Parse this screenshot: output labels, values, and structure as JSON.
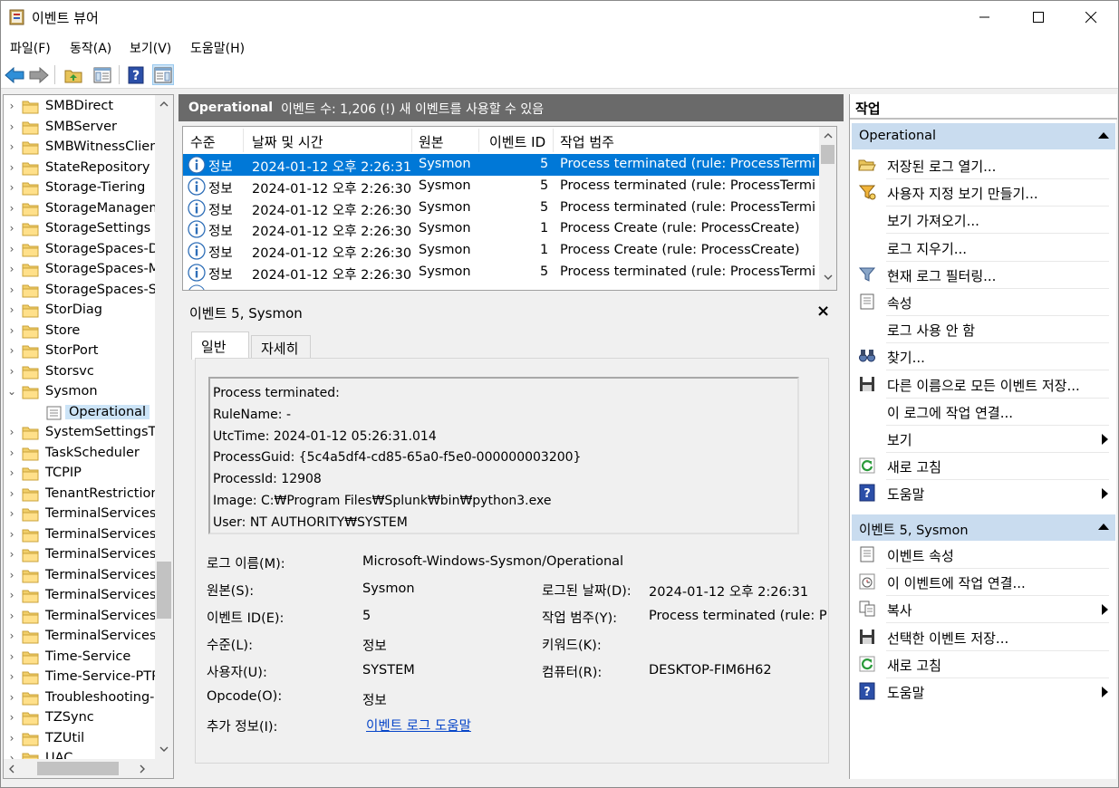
{
  "window": {
    "title": "이벤트 뷰어"
  },
  "menu": [
    "파일(F)",
    "동작(A)",
    "보기(V)",
    "도움말(H)"
  ],
  "tree": {
    "items": [
      {
        "label": "SMBDirect",
        "expanded": false
      },
      {
        "label": "SMBServer",
        "expanded": false
      },
      {
        "label": "SMBWitnessClient",
        "expanded": false
      },
      {
        "label": "StateRepository",
        "expanded": false
      },
      {
        "label": "Storage-Tiering",
        "expanded": false
      },
      {
        "label": "StorageManageme",
        "expanded": false
      },
      {
        "label": "StorageSettings",
        "expanded": false
      },
      {
        "label": "StorageSpaces-Dri",
        "expanded": false
      },
      {
        "label": "StorageSpaces-Ma",
        "expanded": false
      },
      {
        "label": "StorageSpaces-Spa",
        "expanded": false
      },
      {
        "label": "StorDiag",
        "expanded": false
      },
      {
        "label": "Store",
        "expanded": false
      },
      {
        "label": "StorPort",
        "expanded": false
      },
      {
        "label": "Storsvc",
        "expanded": false
      },
      {
        "label": "Sysmon",
        "expanded": true
      },
      {
        "label": "Operational",
        "child": true,
        "selected": true
      },
      {
        "label": "SystemSettingsThr",
        "expanded": false
      },
      {
        "label": "TaskScheduler",
        "expanded": false
      },
      {
        "label": "TCPIP",
        "expanded": false
      },
      {
        "label": "TenantRestrictions",
        "expanded": false
      },
      {
        "label": "TerminalServices-C",
        "expanded": false
      },
      {
        "label": "TerminalServices-C",
        "expanded": false
      },
      {
        "label": "TerminalServices-L",
        "expanded": false
      },
      {
        "label": "TerminalServices-F",
        "expanded": false
      },
      {
        "label": "TerminalServices-F",
        "expanded": false
      },
      {
        "label": "TerminalServices-F",
        "expanded": false
      },
      {
        "label": "TerminalServices-S",
        "expanded": false
      },
      {
        "label": "Time-Service",
        "expanded": false
      },
      {
        "label": "Time-Service-PTP-",
        "expanded": false
      },
      {
        "label": "Troubleshooting-F",
        "expanded": false
      },
      {
        "label": "TZSync",
        "expanded": false
      },
      {
        "label": "TZUtil",
        "expanded": false
      },
      {
        "label": "UAC",
        "expanded": false
      }
    ]
  },
  "log_header": {
    "name": "Operational",
    "count_text": "이벤트 수: 1,206 (!) 새 이벤트를 사용할 수 있음"
  },
  "grid": {
    "columns": [
      "수준",
      "날짜 및 시간",
      "원본",
      "이벤트 ID",
      "작업 범주"
    ],
    "rows": [
      {
        "level": "정보",
        "datetime": "2024-01-12 오후 2:26:31",
        "source": "Sysmon",
        "id": "5",
        "category": "Process terminated (rule: ProcessTermina..."
      },
      {
        "level": "정보",
        "datetime": "2024-01-12 오후 2:26:30",
        "source": "Sysmon",
        "id": "5",
        "category": "Process terminated (rule: ProcessTermina..."
      },
      {
        "level": "정보",
        "datetime": "2024-01-12 오후 2:26:30",
        "source": "Sysmon",
        "id": "5",
        "category": "Process terminated (rule: ProcessTermina..."
      },
      {
        "level": "정보",
        "datetime": "2024-01-12 오후 2:26:30",
        "source": "Sysmon",
        "id": "1",
        "category": "Process Create (rule: ProcessCreate)"
      },
      {
        "level": "정보",
        "datetime": "2024-01-12 오후 2:26:30",
        "source": "Sysmon",
        "id": "1",
        "category": "Process Create (rule: ProcessCreate)"
      },
      {
        "level": "정보",
        "datetime": "2024-01-12 오후 2:26:30",
        "source": "Sysmon",
        "id": "5",
        "category": "Process terminated (rule: ProcessTermina..."
      }
    ]
  },
  "detail": {
    "title": "이벤트 5, Sysmon",
    "close": "×",
    "tabs": [
      "일반",
      "자세히"
    ],
    "message_lines": [
      "Process terminated:",
      "RuleName: -",
      "UtcTime: 2024-01-12 05:26:31.014",
      "ProcessGuid: {5c4a5df4-cd85-65a0-f5e0-000000003200}",
      "ProcessId: 12908",
      "Image: C:₩Program Files₩Splunk₩bin₩python3.exe",
      "User: NT AUTHORITY₩SYSTEM"
    ],
    "props": {
      "log_name_label": "로그 이름(M):",
      "log_name": "Microsoft-Windows-Sysmon/Operational",
      "source_label": "원본(S):",
      "source": "Sysmon",
      "logged_label": "로그된 날짜(D):",
      "logged": "2024-01-12 오후 2:26:31",
      "event_id_label": "이벤트 ID(E):",
      "event_id": "5",
      "task_label": "작업 범주(Y):",
      "task": "Process terminated (rule: P",
      "level_label": "수준(L):",
      "level": "정보",
      "keywords_label": "키워드(K):",
      "user_label": "사용자(U):",
      "user": "SYSTEM",
      "computer_label": "컴퓨터(R):",
      "computer": "DESKTOP-FIM6H62",
      "opcode_label": "Opcode(O):",
      "opcode": "정보",
      "more_label": "추가 정보(I):",
      "more_link": "이벤트 로그 도움말"
    }
  },
  "actions": {
    "title": "작업",
    "section1": {
      "header": "Operational",
      "items": [
        {
          "label": "저장된 로그 열기...",
          "icon": "folder-open-icon"
        },
        {
          "label": "사용자 지정 보기 만들기...",
          "icon": "filter-create-icon"
        },
        {
          "label": "보기 가져오기...",
          "icon": ""
        },
        {
          "label": "로그 지우기...",
          "icon": ""
        },
        {
          "label": "현재 로그 필터링...",
          "icon": "filter-icon"
        },
        {
          "label": "속성",
          "icon": "properties-icon"
        },
        {
          "label": "로그 사용 안 함",
          "icon": ""
        },
        {
          "label": "찾기...",
          "icon": "binoculars-icon"
        },
        {
          "label": "다른 이름으로 모든 이벤트 저장...",
          "icon": "save-icon"
        },
        {
          "label": "이 로그에 작업 연결...",
          "icon": ""
        },
        {
          "label": "보기",
          "icon": "",
          "submenu": true
        },
        {
          "label": "새로 고침",
          "icon": "refresh-icon"
        },
        {
          "label": "도움말",
          "icon": "help-icon",
          "submenu": true
        }
      ]
    },
    "section2": {
      "header": "이벤트 5, Sysmon",
      "items": [
        {
          "label": "이벤트 속성",
          "icon": "event-properties-icon"
        },
        {
          "label": "이 이벤트에 작업 연결...",
          "icon": "task-attach-icon"
        },
        {
          "label": "복사",
          "icon": "copy-icon",
          "submenu": true
        },
        {
          "label": "선택한 이벤트 저장...",
          "icon": "save-icon"
        },
        {
          "label": "새로 고침",
          "icon": "refresh-icon"
        },
        {
          "label": "도움말",
          "icon": "help-icon",
          "submenu": true
        }
      ]
    }
  },
  "colors": {
    "selection": "#0078d7",
    "header_bg": "#6a6a6a",
    "section_bg": "#c9dcef",
    "link": "#0645c8"
  }
}
